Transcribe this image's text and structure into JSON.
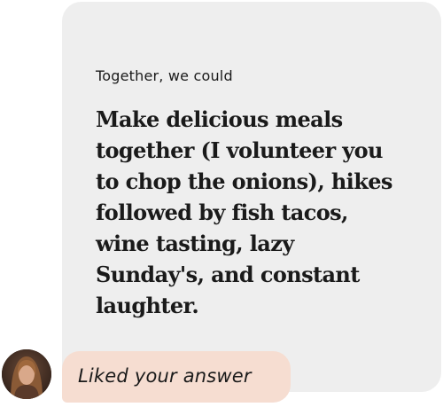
{
  "prompt": {
    "question": "Together, we could",
    "answer": "Make delicious meals together (I volunteer you to chop the onions), hikes followed by fish tacos, wine tasting, lazy Sunday's, and constant laughter."
  },
  "like": {
    "avatar_icon": "user-avatar-photo",
    "message": "Liked your answer",
    "bubble_color": "#f6ddd1"
  },
  "card_color": "#eeeeee"
}
